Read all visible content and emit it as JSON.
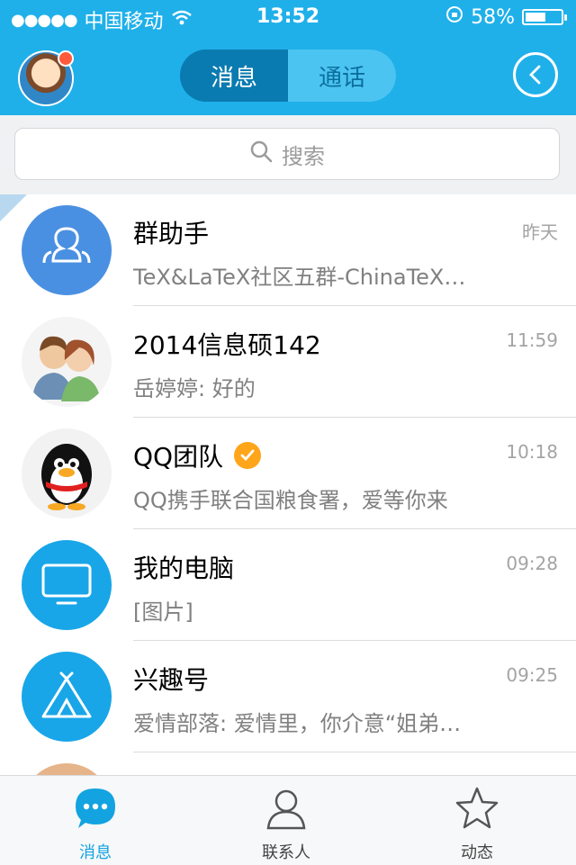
{
  "status_bar": {
    "signal": "●●●●●",
    "carrier": "中国移动",
    "time": "13:52",
    "battery": "58%",
    "battery_level": 0.58
  },
  "header": {
    "tabs": [
      {
        "label": "消息",
        "active": true
      },
      {
        "label": "通话",
        "active": false
      }
    ]
  },
  "search": {
    "placeholder": "搜索"
  },
  "conversations": [
    {
      "name": "群助手",
      "time": "昨天",
      "message": "TeX&LaTeX社区五群-ChinaTeX…",
      "avatar": "group-helper-icon",
      "avatar_color": "#4a90e2"
    },
    {
      "name": "2014信息硕142",
      "time": "11:59",
      "message": "岳婷婷: 好的",
      "avatar": "couple-avatar",
      "avatar_color": "#e8e8e8"
    },
    {
      "name": "QQ团队",
      "time": "10:18",
      "message": "QQ携手联合国粮食署，爱等你来",
      "avatar": "penguin-avatar",
      "avatar_color": "#f2f2f2",
      "verified": true
    },
    {
      "name": "我的电脑",
      "time": "09:28",
      "message": "[图片]",
      "avatar": "monitor-icon",
      "avatar_color": "#18a6e8"
    },
    {
      "name": "兴趣号",
      "time": "09:25",
      "message": "爱情部落: 爱情里，你介意“姐弟…",
      "avatar": "tent-icon",
      "avatar_color": "#18a6e8"
    }
  ],
  "tabbar": {
    "items": [
      {
        "label": "消息",
        "icon": "chat-bubble-icon",
        "active": true
      },
      {
        "label": "联系人",
        "icon": "contacts-icon",
        "active": false
      },
      {
        "label": "动态",
        "icon": "star-icon",
        "active": false
      }
    ]
  },
  "colors": {
    "brand": "#1fb0ea",
    "accent": "#12a3e0",
    "verified": "#ffa51a"
  }
}
